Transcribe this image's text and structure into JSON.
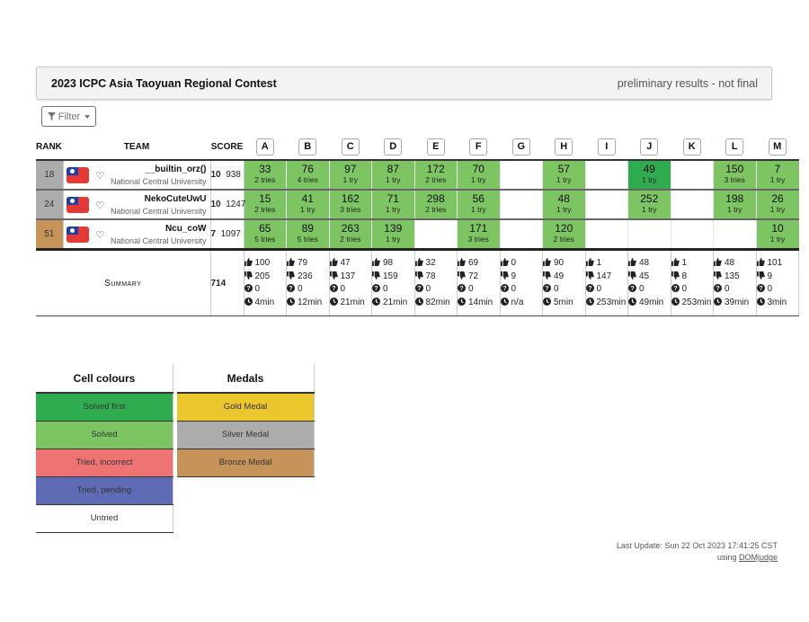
{
  "header": {
    "title": "2023 ICPC Asia Taoyuan Regional Contest",
    "note": "preliminary results - not final"
  },
  "filter": {
    "label": "Filter"
  },
  "columns": {
    "rank": "RANK",
    "team": "TEAM",
    "score": "SCORE"
  },
  "problems": [
    "A",
    "B",
    "C",
    "D",
    "E",
    "F",
    "G",
    "H",
    "I",
    "J",
    "K",
    "L",
    "M"
  ],
  "colors": {
    "solved_first": "#2eac4f",
    "solved": "#7dc462",
    "tried_incorrect": "#ee7474",
    "tried_pending": "#5f6bb4",
    "untried": "#ffffff",
    "gold": "#ebc72e",
    "silver": "#acacac",
    "bronze": "#c6935a"
  },
  "teams": [
    {
      "rank": "18",
      "medal": "silver",
      "flag": "taiwan-flag",
      "name": "__builtin_orz()",
      "affiliation": "National Central University",
      "solved": "10",
      "penalty": "938",
      "cells": [
        {
          "time": "33",
          "tries": "2 tries",
          "status": "solved"
        },
        {
          "time": "76",
          "tries": "4 tries",
          "status": "solved"
        },
        {
          "time": "97",
          "tries": "1 try",
          "status": "solved"
        },
        {
          "time": "87",
          "tries": "1 try",
          "status": "solved"
        },
        {
          "time": "172",
          "tries": "2 tries",
          "status": "solved"
        },
        {
          "time": "70",
          "tries": "1 try",
          "status": "solved"
        },
        {
          "time": "",
          "tries": "",
          "status": "untried"
        },
        {
          "time": "57",
          "tries": "1 try",
          "status": "solved"
        },
        {
          "time": "",
          "tries": "",
          "status": "untried"
        },
        {
          "time": "49",
          "tries": "1 try",
          "status": "first"
        },
        {
          "time": "",
          "tries": "",
          "status": "untried"
        },
        {
          "time": "150",
          "tries": "3 tries",
          "status": "solved"
        },
        {
          "time": "7",
          "tries": "1 try",
          "status": "solved"
        }
      ]
    },
    {
      "rank": "24",
      "medal": "silver",
      "flag": "taiwan-flag",
      "name": "NekoCuteUwU",
      "affiliation": "National Central University",
      "solved": "10",
      "penalty": "1247",
      "cells": [
        {
          "time": "15",
          "tries": "2 tries",
          "status": "solved"
        },
        {
          "time": "41",
          "tries": "1 try",
          "status": "solved"
        },
        {
          "time": "162",
          "tries": "3 tries",
          "status": "solved"
        },
        {
          "time": "71",
          "tries": "1 try",
          "status": "solved"
        },
        {
          "time": "298",
          "tries": "2 tries",
          "status": "solved"
        },
        {
          "time": "56",
          "tries": "1 try",
          "status": "solved"
        },
        {
          "time": "",
          "tries": "",
          "status": "untried"
        },
        {
          "time": "48",
          "tries": "1 try",
          "status": "solved"
        },
        {
          "time": "",
          "tries": "",
          "status": "untried"
        },
        {
          "time": "252",
          "tries": "1 try",
          "status": "solved"
        },
        {
          "time": "",
          "tries": "",
          "status": "untried"
        },
        {
          "time": "198",
          "tries": "1 try",
          "status": "solved"
        },
        {
          "time": "26",
          "tries": "1 try",
          "status": "solved"
        }
      ]
    },
    {
      "rank": "51",
      "medal": "bronze",
      "flag": "taiwan-flag",
      "name": "Ncu_coW",
      "affiliation": "National Central University",
      "solved": "7",
      "penalty": "1097",
      "cells": [
        {
          "time": "65",
          "tries": "5 tries",
          "status": "solved"
        },
        {
          "time": "89",
          "tries": "5 tries",
          "status": "solved"
        },
        {
          "time": "263",
          "tries": "2 tries",
          "status": "solved"
        },
        {
          "time": "139",
          "tries": "1 try",
          "status": "solved"
        },
        {
          "time": "",
          "tries": "",
          "status": "untried"
        },
        {
          "time": "171",
          "tries": "3 tries",
          "status": "solved"
        },
        {
          "time": "",
          "tries": "",
          "status": "untried"
        },
        {
          "time": "120",
          "tries": "2 tries",
          "status": "solved"
        },
        {
          "time": "",
          "tries": "",
          "status": "untried"
        },
        {
          "time": "",
          "tries": "",
          "status": "untried"
        },
        {
          "time": "",
          "tries": "",
          "status": "untried"
        },
        {
          "time": "",
          "tries": "",
          "status": "untried"
        },
        {
          "time": "10",
          "tries": "1 try",
          "status": "solved"
        }
      ]
    }
  ],
  "summary": {
    "label": "Summary",
    "total": "714",
    "cells": [
      {
        "correct": "100",
        "incorrect": "205",
        "pending": "0",
        "first": "4min"
      },
      {
        "correct": "79",
        "incorrect": "236",
        "pending": "0",
        "first": "12min"
      },
      {
        "correct": "47",
        "incorrect": "137",
        "pending": "0",
        "first": "21min"
      },
      {
        "correct": "98",
        "incorrect": "159",
        "pending": "0",
        "first": "21min"
      },
      {
        "correct": "32",
        "incorrect": "78",
        "pending": "0",
        "first": "82min"
      },
      {
        "correct": "69",
        "incorrect": "72",
        "pending": "0",
        "first": "14min"
      },
      {
        "correct": "0",
        "incorrect": "9",
        "pending": "0",
        "first": "n/a"
      },
      {
        "correct": "90",
        "incorrect": "49",
        "pending": "0",
        "first": "5min"
      },
      {
        "correct": "1",
        "incorrect": "147",
        "pending": "0",
        "first": "253min"
      },
      {
        "correct": "48",
        "incorrect": "45",
        "pending": "0",
        "first": "49min"
      },
      {
        "correct": "1",
        "incorrect": "8",
        "pending": "0",
        "first": "253min"
      },
      {
        "correct": "48",
        "incorrect": "135",
        "pending": "0",
        "first": "39min"
      },
      {
        "correct": "101",
        "incorrect": "9",
        "pending": "0",
        "first": "3min"
      }
    ]
  },
  "legend_cells": {
    "title": "Cell colours",
    "items": [
      {
        "label": "Solved first",
        "color": "#2eac4f"
      },
      {
        "label": "Solved",
        "color": "#7dc462"
      },
      {
        "label": "Tried, incorrect",
        "color": "#ee7474"
      },
      {
        "label": "Tried, pending",
        "color": "#5f6bb4"
      },
      {
        "label": "Untried",
        "color": "#ffffff"
      }
    ]
  },
  "legend_medals": {
    "title": "Medals",
    "items": [
      {
        "label": "Gold Medal",
        "color": "#ebc72e"
      },
      {
        "label": "Silver Medal",
        "color": "#acacac"
      },
      {
        "label": "Bronze Medal",
        "color": "#c6935a"
      }
    ]
  },
  "footer": {
    "last_update": "Last Update: Sun 22 Oct 2023 17:41:25 CST",
    "using": "using",
    "link": "DOMjudge"
  }
}
